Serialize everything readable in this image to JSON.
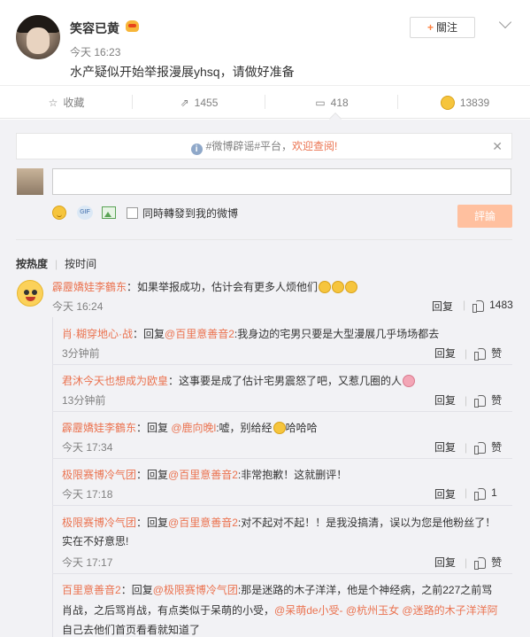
{
  "post": {
    "username": "笑容已黄",
    "time": "今天 16:23",
    "text": "水产疑似开始举报漫展yhsq，请做好准备",
    "follow_label": "關注",
    "follow_plus": "+"
  },
  "actions": {
    "favorite": "收藏",
    "repost": "1455",
    "comment": "418",
    "like": "13839"
  },
  "notice": {
    "prefix": "#微博辟谣#平台，",
    "link": "欢迎查阅!",
    "close": "✕"
  },
  "composer": {
    "repost_also": "同時轉發到我的微博",
    "submit": "評論"
  },
  "sort": {
    "by_hot": "按热度",
    "by_time": "按时间"
  },
  "comment": {
    "name": "霹靂嬌娃李鶴东",
    "text": "：如果举报成功，估计会有更多人烦他们",
    "time": "今天 16:24",
    "reply_label": "回复",
    "likes": "1483"
  },
  "replies": [
    {
      "name": "肖·糊穿地心·战",
      "pre": "：回复",
      "at": "@百里意善音2",
      "text": ":我身边的宅男只要是大型漫展几乎场场都去",
      "time": "3分钟前",
      "reply_label": "回复",
      "like_label": "赞"
    },
    {
      "name": "君沐今天也想成为欧皇",
      "pre": "：这事要是成了估计宅男震怒了吧，又惹几圈的人",
      "at": "",
      "text": "",
      "time": "13分钟前",
      "reply_label": "回复",
      "like_label": "赞"
    },
    {
      "name": "霹靂嬌娃李鶴东",
      "pre": "：回复 ",
      "at": "@鹿向晚l",
      "text": ":嘘，别给经",
      "text2": "哈哈哈",
      "time": "今天 17:34",
      "reply_label": "回复",
      "like_label": "赞"
    },
    {
      "name": "极限赛博冷气团",
      "pre": "：回复",
      "at": "@百里意善音2",
      "text": ":非常抱歉！这就删评！",
      "time": "今天 17:18",
      "reply_label": "回复",
      "like_label": "1"
    },
    {
      "name": "极限赛博冷气团",
      "pre": "：回复",
      "at": "@百里意善音2",
      "text": ":对不起对不起！！是我没搞清，误以为您是他粉丝了！",
      "line2": "实在不好意思!",
      "time": "今天 17:17",
      "reply_label": "回复",
      "like_label": "赞"
    },
    {
      "name": "百里意善音2",
      "pre": "：回复",
      "at": "@极限赛博冷气团",
      "text": ":那是迷路的木子洋洋，他是个神经病，之前227之前骂",
      "line2a": "肖战，之后骂肖战，有点类似于呆萌的小受，",
      "at2": "@呆萌de小受-",
      "at3": "@杭州玉女",
      "at4": "@迷路的木子洋洋阿",
      "line3": "自己去他们首页看看就知道了"
    }
  ]
}
